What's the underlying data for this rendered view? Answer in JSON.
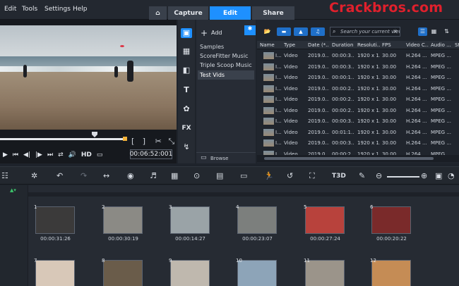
{
  "menu": [
    "Edit",
    "Tools",
    "Settings",
    "Help"
  ],
  "tabs": {
    "capture": "Capture",
    "edit": "Edit",
    "share": "Share"
  },
  "watermark": "Crackbros.com",
  "player": {
    "timecode": "00:06:52:001",
    "hd_label": "HD"
  },
  "library_nav": {
    "fx_label": "FX"
  },
  "folders": {
    "add_label": "Add",
    "items": [
      "Samples",
      "ScoreFitter Music",
      "Triple Scoop Music",
      "Test Vids"
    ],
    "browse_label": "Browse"
  },
  "library": {
    "search_placeholder": "Search your current view",
    "columns": [
      "Name",
      "Type",
      "Date (*...",
      "Duration",
      "Resoluti...",
      "FPS",
      "Video C...",
      "Audio ...",
      "St"
    ],
    "rows": [
      [
        "I...",
        "Video",
        "2019.0...",
        "00:00:3...",
        "1920 x 1...",
        "30.00",
        "H.264 ...",
        "MPEG ..."
      ],
      [
        "I...",
        "Video",
        "2019.0...",
        "00:00:3...",
        "1920 x 1...",
        "30.00",
        "H.264 ...",
        "MPEG ..."
      ],
      [
        "I...",
        "Video",
        "2019.0...",
        "00:00:1...",
        "1920 x 1...",
        "30.00",
        "H.264 ...",
        "MPEG ..."
      ],
      [
        "I...",
        "Video",
        "2019.0...",
        "00:00:2...",
        "1920 x 1...",
        "30.00",
        "H.264 ...",
        "MPEG ..."
      ],
      [
        "I...",
        "Video",
        "2019.0...",
        "00:00:2...",
        "1920 x 1...",
        "30.00",
        "H.264 ...",
        "MPEG ..."
      ],
      [
        "I...",
        "Video",
        "2019.0...",
        "00:00:2...",
        "1920 x 1...",
        "30.00",
        "H.264 ...",
        "MPEG ..."
      ],
      [
        "I...",
        "Video",
        "2019.0...",
        "00:00:3...",
        "1920 x 1...",
        "30.00",
        "H.264 ...",
        "MPEG ..."
      ],
      [
        "I...",
        "Video",
        "2019.0...",
        "00:01:1...",
        "1920 x 1...",
        "30.00",
        "H.264 ...",
        "MPEG ..."
      ],
      [
        "I...",
        "Video",
        "2019.0...",
        "00:00:3...",
        "1920 x 1...",
        "30.00",
        "H.264 ...",
        "MPEG ..."
      ],
      [
        "I...",
        "Video",
        "2019.0...",
        "00:00:2...",
        "1920 x 1...",
        "30.00",
        "H.264 ...",
        "MPEG ..."
      ]
    ]
  },
  "timeline": {
    "title_tool_label": "T3D"
  },
  "storyboard": {
    "clips": [
      {
        "num": "1",
        "time": "00:00:31:26",
        "color": "#3b3a3a"
      },
      {
        "num": "2",
        "time": "00:00:30:19",
        "color": "#8b8a85"
      },
      {
        "num": "3",
        "time": "00:00:14:27",
        "color": "#9aa3a7"
      },
      {
        "num": "4",
        "time": "00:00:23:07",
        "color": "#7c7f7d"
      },
      {
        "num": "5",
        "time": "00:00:27:24",
        "color": "#b8423c"
      },
      {
        "num": "6",
        "time": "00:00:20:22",
        "color": "#7a2a2a"
      }
    ],
    "clips_row2": [
      {
        "num": "7",
        "color": "#d8c8b8"
      },
      {
        "num": "8",
        "color": "#6a5c4a"
      },
      {
        "num": "9",
        "color": "#bfb8ae"
      },
      {
        "num": "10",
        "color": "#8da4b8"
      },
      {
        "num": "11",
        "color": "#9b948a"
      },
      {
        "num": "12",
        "color": "#c58c55"
      }
    ]
  }
}
